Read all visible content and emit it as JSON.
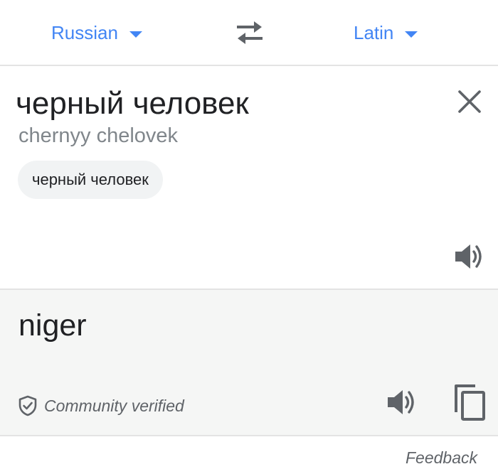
{
  "language_bar": {
    "source_language": "Russian",
    "target_language": "Latin",
    "swap_icon": "swap-arrows-icon",
    "caret_icon": "caret-down-icon",
    "accent_color": "#4285f4"
  },
  "source_panel": {
    "text": "черный человек",
    "transliteration": "chernyy chelovek",
    "suggestion_chip": "черный человек",
    "close_icon": "close-icon",
    "speaker_icon": "speaker-icon"
  },
  "result_panel": {
    "text": "niger",
    "verified_label": "Community verified",
    "verified_icon": "shield-check-icon",
    "speaker_icon": "speaker-icon",
    "copy_icon": "copy-icon",
    "background_color": "#f5f6f5"
  },
  "footer": {
    "feedback_label": "Feedback"
  }
}
